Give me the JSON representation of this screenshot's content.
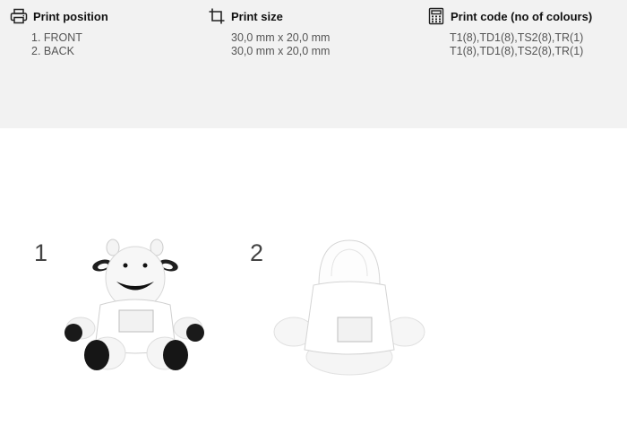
{
  "columns": [
    {
      "icon": "printer-icon",
      "title": "Print position",
      "rows": [
        "1. FRONT",
        "2. BACK"
      ]
    },
    {
      "icon": "crop-icon",
      "title": "Print size",
      "rows": [
        "30,0 mm x 20,0 mm",
        "30,0 mm x 20,0 mm"
      ]
    },
    {
      "icon": "calculator-icon",
      "title": "Print code (no of colours)",
      "rows": [
        "T1(8),TD1(8),TS2(8),TR(1)",
        "T1(8),TD1(8),TS2(8),TR(1)"
      ]
    }
  ],
  "positions": [
    {
      "number": "1",
      "view": "front"
    },
    {
      "number": "2",
      "view": "back"
    }
  ]
}
